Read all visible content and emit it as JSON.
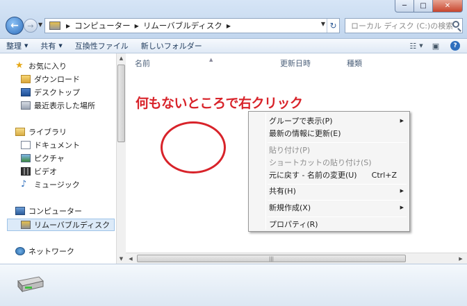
{
  "window": {
    "buttons": {
      "minimize": "─",
      "maximize": "□",
      "close": "✕"
    }
  },
  "address": {
    "crumbs": [
      "コンピューター",
      "リムーバブルディスク"
    ]
  },
  "search": {
    "placeholder": "ローカル ディスク (C:)の検索"
  },
  "toolbar": {
    "organize": "整理",
    "share": "共有",
    "compat_files": "互換性ファイル",
    "new_folder": "新しいフォルダー"
  },
  "sidebar": {
    "favorites": "お気に入り",
    "downloads": "ダウンロード",
    "desktop": "デスクトップ",
    "recent": "最近表示した場所",
    "libraries": "ライブラリ",
    "documents": "ドキュメント",
    "pictures": "ピクチャ",
    "videos": "ビデオ",
    "music": "ミュージック",
    "computer": "コンピューター",
    "removable": "リムーバブルディスク",
    "network": "ネットワーク"
  },
  "columns": {
    "name": "名前",
    "modified": "更新日時",
    "type": "種類"
  },
  "annotation": "何もないところで右クリック",
  "context_menu": {
    "group_by": "グループで表示(P)",
    "refresh": "最新の情報に更新(E)",
    "paste": "貼り付け(P)",
    "paste_shortcut": "ショートカットの貼り付け(S)",
    "undo": "元に戻す - 名前の変更(U)",
    "undo_shortcut": "Ctrl+Z",
    "share": "共有(H)",
    "new": "新規作成(X)",
    "properties": "プロパティ(R)"
  },
  "colors": {
    "annotation": "#d8232a",
    "selection": "#dceaf8"
  }
}
